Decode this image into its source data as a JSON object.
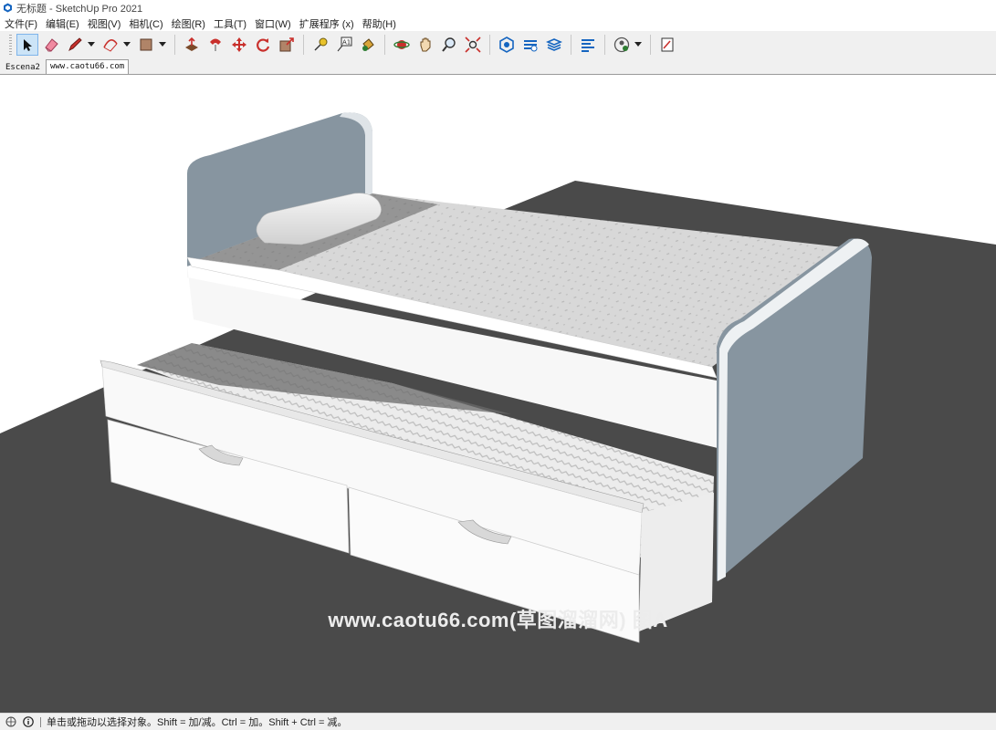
{
  "window": {
    "title": "无标题 - SketchUp Pro 2021",
    "app_icon": "sketchup-logo-icon"
  },
  "menu": {
    "items": [
      "文件(F)",
      "编辑(E)",
      "视图(V)",
      "相机(C)",
      "绘图(R)",
      "工具(T)",
      "窗口(W)",
      "扩展程序 (x)",
      "帮助(H)"
    ]
  },
  "toolbar": {
    "tools": [
      "select-icon",
      "eraser-icon",
      "pencil-line-icon",
      "arc-icon",
      "rectangle-icon",
      "push-pull-icon",
      "follow-me-icon",
      "move-icon",
      "rotate-icon",
      "scale-icon",
      "tape-measure-icon",
      "text-icon",
      "paint-bucket-icon",
      "orbit-icon",
      "pan-icon",
      "zoom-icon",
      "zoom-extents-icon",
      "warehouse-icon",
      "extension-warehouse-icon",
      "layers-icon",
      "styles-icon",
      "profile-icon",
      "layout-icon"
    ],
    "active_tool": "select-icon"
  },
  "tabs": {
    "scene1": "Escena2",
    "scene2": "www.caotu66.com"
  },
  "viewport": {
    "watermark": "www.caotu66.com(草图溜溜网) 图A",
    "colors": {
      "ground": "#4a4a4a",
      "headboard": "#8795a0",
      "bed_white": "#fafafa",
      "mattress": "#d6d6d6"
    }
  },
  "status": {
    "hint": "单击或拖动以选择对象。Shift = 加/减。Ctrl = 加。Shift + Ctrl = 减。"
  }
}
